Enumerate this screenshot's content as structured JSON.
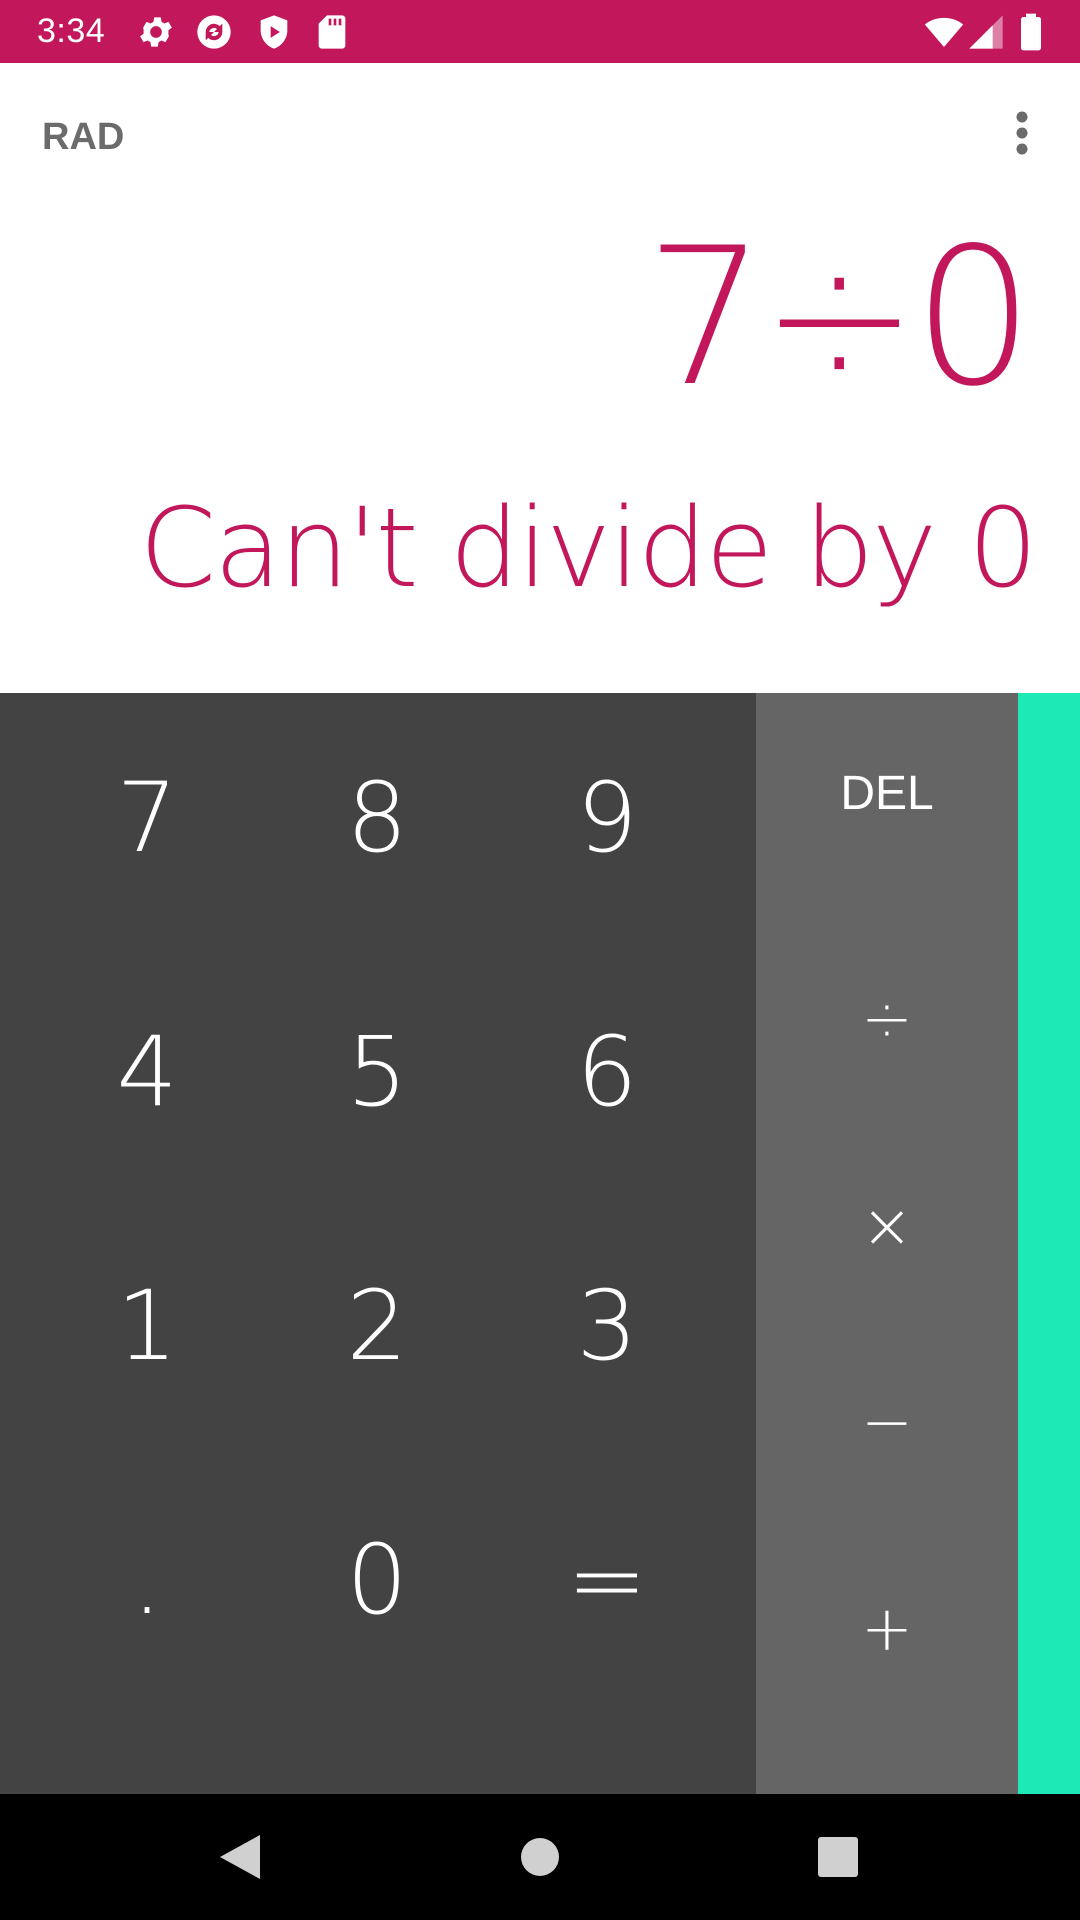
{
  "status_bar": {
    "time": "3:34",
    "background": "#c2185b",
    "icons_left": [
      "gear-icon",
      "sync-icon",
      "shield-play-icon",
      "sd-card-icon"
    ],
    "icons_right": [
      "wifi-icon",
      "cell-signal-icon",
      "battery-icon"
    ]
  },
  "display": {
    "mode": "RAD",
    "expression": "7÷0",
    "result": "Can't divide by 0",
    "accent": "#c2185b"
  },
  "keypad": {
    "digits": [
      [
        "7",
        "8",
        "9"
      ],
      [
        "4",
        "5",
        "6"
      ],
      [
        "1",
        "2",
        "3"
      ],
      [
        ".",
        "0",
        "="
      ]
    ],
    "operators": [
      "DEL",
      "÷",
      "×",
      "−",
      "+"
    ],
    "advanced_panel_color": "#1de9b6"
  },
  "nav_bar": {
    "icons": [
      "back-icon",
      "home-icon",
      "recents-icon"
    ]
  }
}
